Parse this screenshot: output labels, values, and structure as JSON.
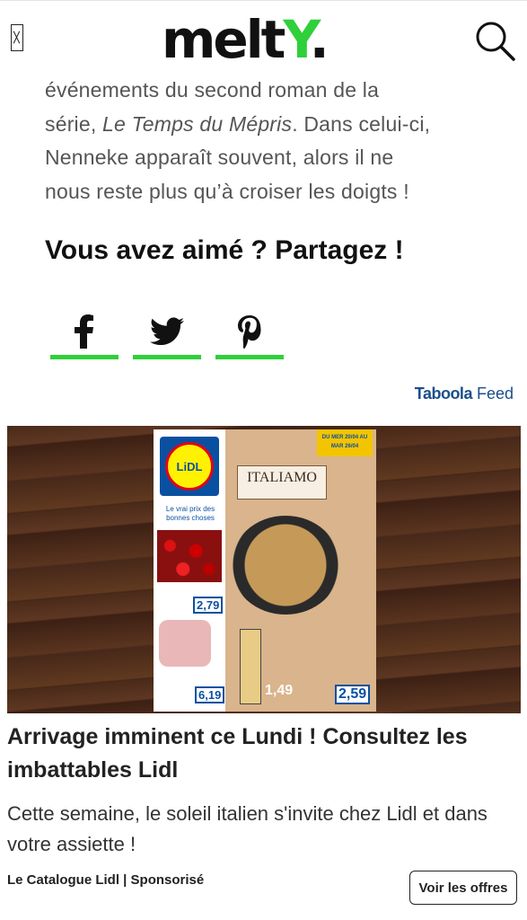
{
  "header": {
    "logo_text": "melt",
    "logo_accent": "Y",
    "logo_dot": ".",
    "menu_icon": "menu-icon",
    "search_icon": "search-icon"
  },
  "article": {
    "line1": "événements du second roman de la",
    "line2_before": "série, ",
    "line2_italic": "Le Temps du Mépris",
    "line2_after": ". Dans celui-ci,",
    "line3": "Nenneke apparaît souvent, alors il ne",
    "line4": "nous reste plus qu’à croiser les doigts !"
  },
  "share": {
    "title": "Vous avez aimé ? Partagez !",
    "buttons": [
      {
        "network": "facebook",
        "icon": "facebook-icon"
      },
      {
        "network": "twitter",
        "icon": "twitter-icon"
      },
      {
        "network": "pinterest",
        "icon": "pinterest-icon"
      }
    ]
  },
  "taboola": {
    "brand": "Taboola",
    "feed": "Feed"
  },
  "ad": {
    "image": {
      "lidl_logo": "LiDL",
      "slogan": "Le vrai prix des bonnes choses",
      "italiamo": "ITALIAMO",
      "date_badge": "DU MER 20/04 AU MAR 26/04",
      "prices": [
        "2,79",
        "6,19",
        "1,49",
        "2,59"
      ]
    },
    "title": "Arrivage imminent ce Lundi ! Consultez les imbattables Lidl",
    "description": "Cette semaine, le soleil italien s'invite chez Lidl et dans votre assiette !",
    "source": "Le Catalogue Lidl | Sponsorisé",
    "cta": "Voir les offres"
  },
  "colors": {
    "brand_green": "#2fd03a",
    "taboola_blue": "#1a4f8a",
    "lidl_blue": "#0a50a1"
  }
}
